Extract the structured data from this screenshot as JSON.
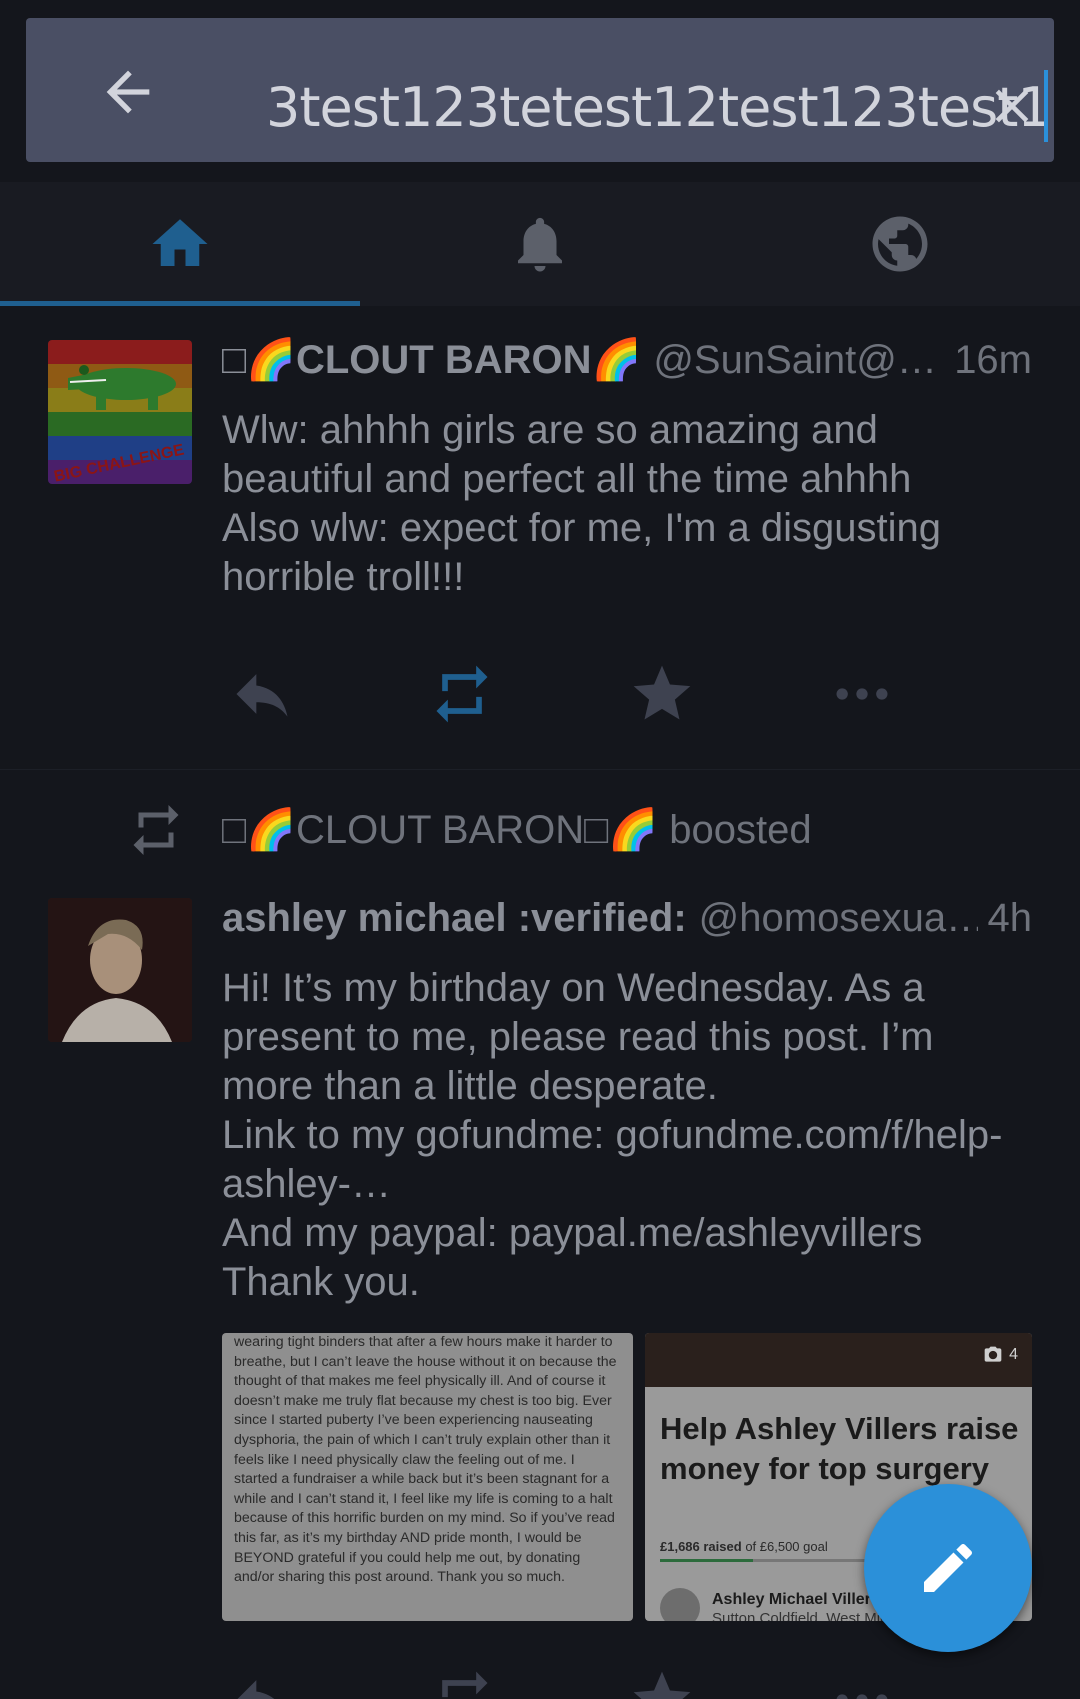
{
  "search": {
    "query": "3test123tetest12test123test123test",
    "back_icon": "arrow-left-icon",
    "clear_icon": "close-icon"
  },
  "tabs": [
    {
      "name": "home",
      "icon": "home-icon",
      "active": true
    },
    {
      "name": "notifications",
      "icon": "bell-icon",
      "active": false
    },
    {
      "name": "federated",
      "icon": "globe-icon",
      "active": false
    }
  ],
  "colors": {
    "accent": "#2b90d9",
    "background": "#14161c",
    "search_bg": "#4a4f64",
    "active_tab": "#1f5f8f"
  },
  "status1": {
    "display_name": "🌈CLOUT BARON🌈",
    "display_name_prefix": "□",
    "acct": "@SunSaint@…",
    "time": "16m",
    "content": "Wlw: ahhhh girls are so amazing and beautiful and perfect all the time ahhhh\nAlso wlw: expect for me, I'm a disgusting horrible troll!!!",
    "avatar_text": "BIG CHALLENGE"
  },
  "boost": {
    "text": "□🌈CLOUT BARON□🌈 boosted"
  },
  "status2": {
    "display_name": "ashley michael :verified:",
    "acct": "@homosexua…",
    "time": "4h",
    "content": "Hi! It’s my birthday on Wednesday. As a present to me, please read this post. I’m more than a little desperate.\nLink to my gofundme: gofundme.com/f/help-ashley-…\nAnd my paypal: paypal.me/ashleyvillers\nThank you.",
    "media_left_text": "wearing tight binders that after a few hours make it harder to breathe, but I can’t leave the house without it on because the thought of that makes me feel physically ill. And of course it doesn’t make me truly flat because my chest is too big. Ever since I started puberty I’ve been experiencing nauseating dysphoria, the pain of which I can’t truly explain other than it feels like I need physically claw the feeling out of me. I started a fundraiser a while back but it’s been stagnant for a while and I can’t stand it, I feel like my life is coming to a halt because of this horrific burden on my mind. So if you’ve read this far, as it’s my birthday AND pride month, I would be BEYOND grateful if you could help me out, by donating and/or sharing this post around. Thank you so much.",
    "media_count": "4",
    "campaign_title": "Help Ashley Villers raise money for top surgery",
    "raised": "£1,686 raised",
    "goal": "of £6,500 goal",
    "raised_fraction": 0.26,
    "owner": "Ashley Michael Villers",
    "location": "Sutton Coldfield, West Midlands"
  },
  "fab": {
    "icon": "pencil-icon"
  }
}
